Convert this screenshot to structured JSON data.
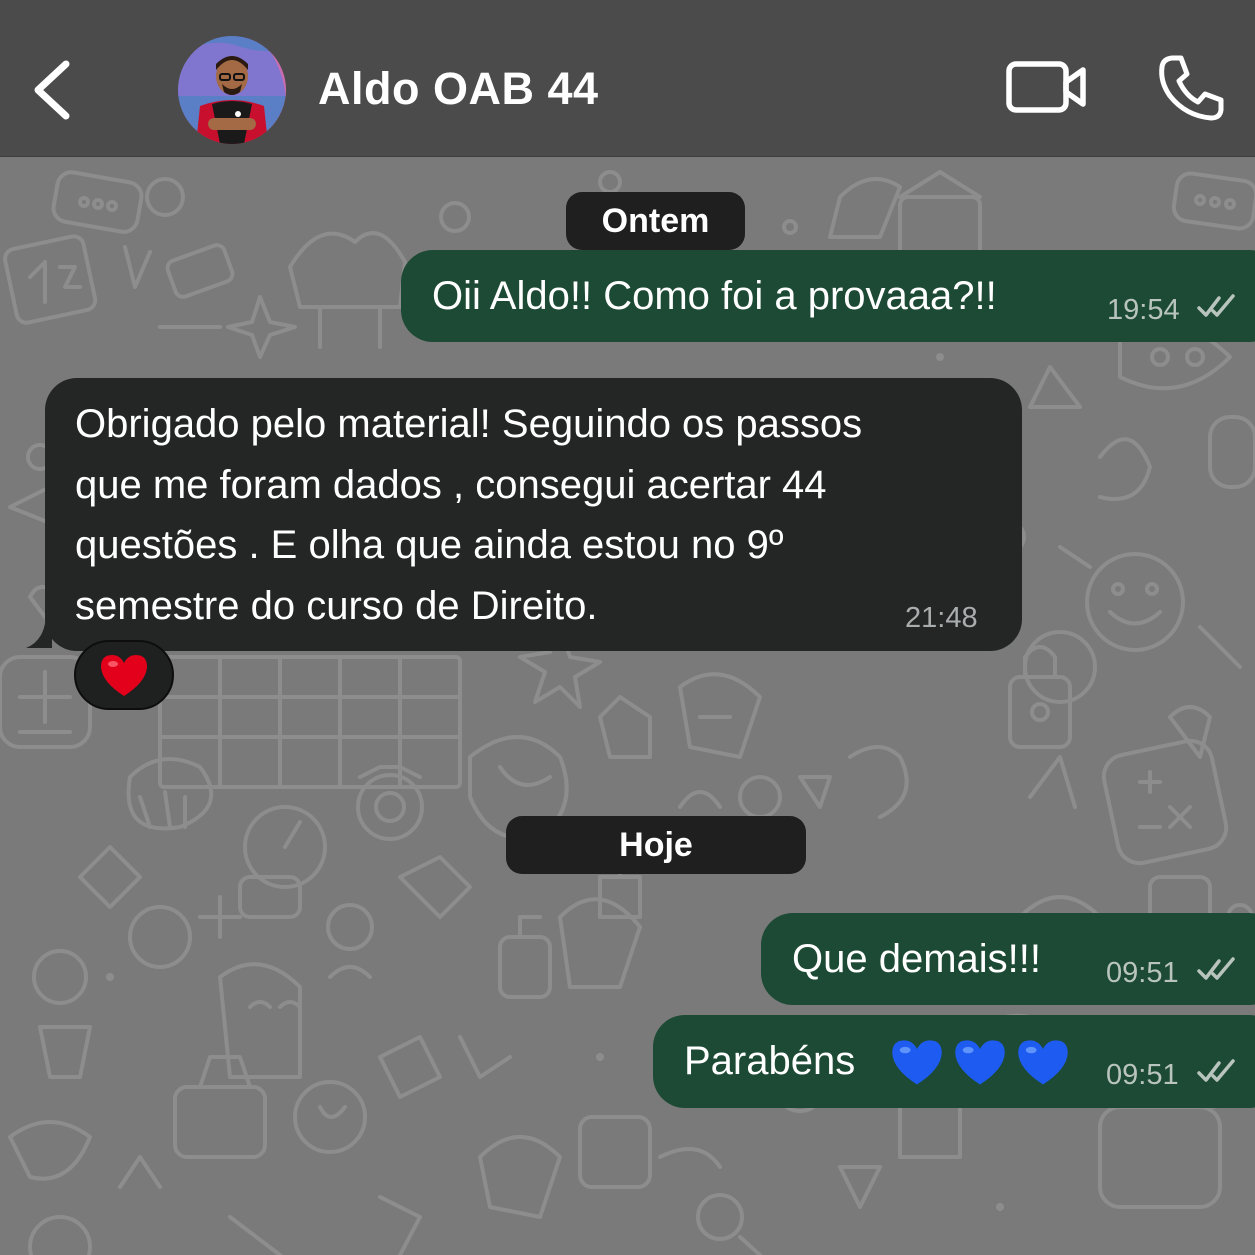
{
  "header": {
    "contact_name": "Aldo OAB 44"
  },
  "dates": {
    "yesterday": "Ontem",
    "today": "Hoje"
  },
  "messages": [
    {
      "direction": "outgoing",
      "text": "Oii Aldo!! Como foi a provaaa?!!",
      "time": "19:54",
      "status": "read"
    },
    {
      "direction": "incoming",
      "lines": [
        "Obrigado pelo material! Seguindo os passos",
        "que me foram dados , consegui acertar 44",
        "questões . E olha que ainda estou no 9º",
        "semestre do curso de Direito."
      ],
      "time": "21:48",
      "reaction": "heart"
    },
    {
      "direction": "outgoing",
      "text": "Que demais!!!",
      "time": "09:51",
      "status": "read"
    },
    {
      "direction": "outgoing",
      "text": "Parabéns",
      "emojis": "blue-heart x3",
      "time": "09:51",
      "status": "read"
    }
  ],
  "colors": {
    "header_bg": "#4b4b4b",
    "wallpaper": "#7a7a7a",
    "outgoing_bubble": "#1d4a34",
    "incoming_bubble": "#242626",
    "date_pill": "#1f1f1f",
    "blue_heart": "#1e5bf0",
    "red_heart": "#e3001b"
  },
  "icons": [
    "back-chevron-icon",
    "video-camera-icon",
    "phone-icon",
    "double-check-icon",
    "red-heart-icon",
    "blue-heart-icon"
  ]
}
